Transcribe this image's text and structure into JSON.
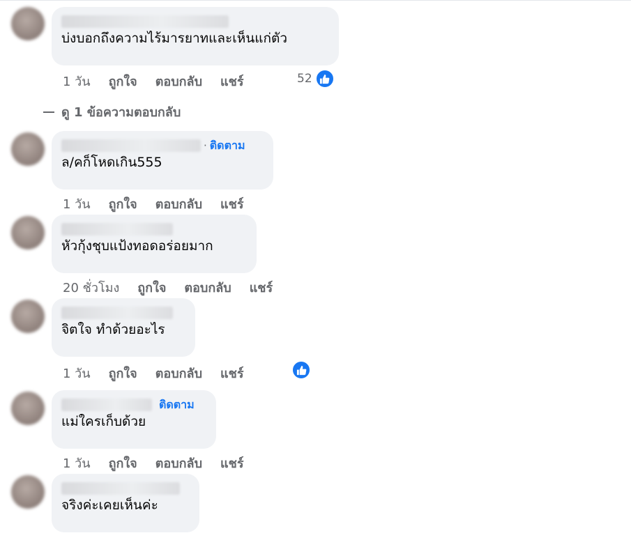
{
  "comments": [
    {
      "text": "บ่งบอกถึงความไร้มารยาทและเห็นแก่ตัว",
      "time": "1 วัน",
      "reaction_count": "52",
      "follow": ""
    },
    {
      "text": "ล/คก็โหดเกิน555",
      "time": "1 วัน",
      "reaction_count": "",
      "follow": "ติดตาม"
    },
    {
      "text": "หัวกุ้งชุบแป้งทอดอร่อยมาก",
      "time": "20 ชั่วโมง",
      "reaction_count": "",
      "follow": ""
    },
    {
      "text": "จิตใจ ทำด้วยอะไร",
      "time": "1 วัน",
      "reaction_count": "",
      "follow": ""
    },
    {
      "text": "แม่ใครเก็บด้วย",
      "time": "1 วัน",
      "reaction_count": "",
      "follow": "ติดตาม"
    },
    {
      "text": "จริงค่ะเคยเห็นค่ะ",
      "time": "",
      "reaction_count": "",
      "follow": ""
    }
  ],
  "actions": {
    "like": "ถูกใจ",
    "reply": "ตอบกลับ",
    "share": "แชร์"
  },
  "view_replies": "ดู 1 ข้อความตอบกลับ",
  "icons": {
    "like": "thumbs-up-icon"
  },
  "colors": {
    "accent": "#1877f2",
    "bubble": "#f0f2f5",
    "muted": "#65676b"
  }
}
